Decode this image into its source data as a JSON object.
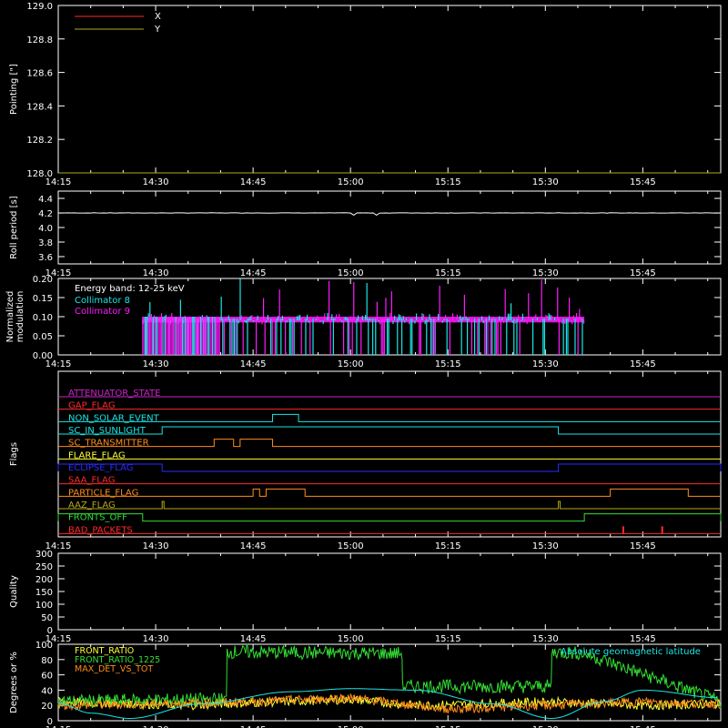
{
  "colors": {
    "background": "#000000",
    "axes": "#ffffff",
    "red": "#ff2a2a",
    "olive": "#b5a818",
    "white": "#ffffff",
    "cyan": "#19e6e6",
    "magenta": "#ff1aff",
    "green": "#33dd33",
    "orange": "#ff8c1a",
    "yellow": "#ffff33",
    "blue": "#2a2aff",
    "purple": "#cc22cc"
  },
  "time_axis": {
    "start": "14:15",
    "end": "15:57",
    "tick_labels": [
      "14:15",
      "14:30",
      "14:45",
      "15:00",
      "15:15",
      "15:30",
      "15:45"
    ]
  },
  "chart_data": [
    {
      "type": "line",
      "id": "pointing",
      "ylabel": "Pointing [\"]",
      "ylim": [
        128.0,
        129.0
      ],
      "yticks": [
        "128.0",
        "128.2",
        "128.4",
        "128.6",
        "128.8",
        "129.0"
      ],
      "legend_position": "top-left",
      "series": [
        {
          "name": "X",
          "color": "red",
          "x": [
            "14:15",
            "15:57"
          ],
          "values": [
            128.0,
            128.0
          ]
        },
        {
          "name": "Y",
          "color": "olive",
          "x": [
            "14:15",
            "15:57"
          ],
          "values": [
            128.0,
            128.0
          ]
        }
      ]
    },
    {
      "type": "line",
      "id": "roll",
      "ylabel": "Roll period [s]",
      "ylim": [
        3.5,
        4.5
      ],
      "yticks": [
        "3.6",
        "3.8",
        "4.0",
        "4.2",
        "4.4"
      ],
      "series": [
        {
          "color": "white",
          "x": [
            "14:15",
            "14:30",
            "14:45",
            "15:00",
            "15:15",
            "15:30",
            "15:45",
            "15:57"
          ],
          "values": [
            4.21,
            4.2,
            4.21,
            4.2,
            4.21,
            4.2,
            4.21,
            4.2
          ]
        }
      ]
    },
    {
      "type": "bar",
      "id": "modulation",
      "ylabel": "Normalized modulation",
      "ylim": [
        0,
        0.2
      ],
      "yticks": [
        "0.00",
        "0.05",
        "0.10",
        "0.15",
        "0.20"
      ],
      "annotation": "Energy band: 12-25 keV",
      "legend_position": "top-left",
      "active_ranges": [
        [
          "14:28",
          "15:36"
        ]
      ],
      "series": [
        {
          "name": "Collimator 8",
          "color": "cyan",
          "level": 0.09
        },
        {
          "name": "Collimator 9",
          "color": "magenta",
          "level": 0.09
        }
      ]
    },
    {
      "type": "line",
      "id": "flags",
      "ylabel": "Flags",
      "flags": [
        {
          "label": "ATTENUATOR_STATE",
          "color": "purple",
          "highs": []
        },
        {
          "label": "GAP_FLAG",
          "color": "red",
          "highs": []
        },
        {
          "label": "NON_SOLAR_EVENT",
          "color": "cyan",
          "highs": [
            [
              "14:48",
              "14:52"
            ]
          ]
        },
        {
          "label": "SC_IN_SUNLIGHT",
          "color": "cyan",
          "highs": [
            [
              "14:31",
              "15:32"
            ]
          ]
        },
        {
          "label": "SC_TRANSMITTER",
          "color": "orange",
          "highs": [
            [
              "14:39",
              "14:42"
            ],
            [
              "14:43",
              "14:48"
            ]
          ]
        },
        {
          "label": "FLARE_FLAG",
          "color": "yellow",
          "highs": []
        },
        {
          "label": "ECLIPSE_FLAG",
          "color": "blue",
          "highs": [
            [
              "14:15",
              "14:31"
            ],
            [
              "15:32",
              "15:57"
            ]
          ]
        },
        {
          "label": "SAA_FLAG",
          "color": "red",
          "highs": []
        },
        {
          "label": "PARTICLE_FLAG",
          "color": "orange",
          "highs": [
            [
              "14:45",
              "14:46"
            ],
            [
              "14:47",
              "14:53"
            ],
            [
              "15:40",
              "15:52"
            ]
          ]
        },
        {
          "label": "AAZ_FLAG",
          "color": "olive",
          "highs": [
            [
              "14:31",
              "14:31"
            ],
            [
              "15:32",
              "15:32"
            ]
          ]
        },
        {
          "label": "FRONTS_OFF",
          "color": "green",
          "highs": [
            [
              "14:15",
              "14:28"
            ],
            [
              "15:36",
              "15:57"
            ]
          ]
        },
        {
          "label": "BAD_PACKETS",
          "color": "red",
          "highs": [],
          "spikes": [
            "15:42",
            "15:48"
          ]
        }
      ]
    },
    {
      "type": "line",
      "id": "quality",
      "ylabel": "Quality",
      "ylim": [
        0,
        300
      ],
      "yticks": [
        "0",
        "50",
        "100",
        "150",
        "200",
        "250",
        "300"
      ],
      "series": []
    },
    {
      "type": "line",
      "id": "ratios",
      "ylabel": "Degrees or %",
      "ylim": [
        0,
        100
      ],
      "yticks": [
        "0",
        "20",
        "40",
        "60",
        "80",
        "100"
      ],
      "legend_position": "top-left",
      "legend_right": "Absolute geomagnetic latitude",
      "series": [
        {
          "name": "FRONT_RATIO",
          "color": "yellow",
          "x": [
            "14:15",
            "14:35",
            "14:40",
            "15:00",
            "15:10",
            "15:20",
            "15:30",
            "15:45",
            "15:57"
          ],
          "values": [
            25,
            20,
            22,
            28,
            20,
            22,
            25,
            20,
            22
          ]
        },
        {
          "name": "FRONT_RATIO_1225",
          "color": "green",
          "x": [
            "14:15",
            "14:40",
            "14:41",
            "15:06",
            "15:08",
            "15:30",
            "15:31",
            "15:36",
            "15:57"
          ],
          "values": [
            25,
            28,
            90,
            88,
            45,
            45,
            90,
            88,
            25
          ]
        },
        {
          "name": "MAX_DET_VS_TOT",
          "color": "orange",
          "x": [
            "14:15",
            "14:30",
            "14:45",
            "15:00",
            "15:15",
            "15:30",
            "15:45",
            "15:57"
          ],
          "values": [
            20,
            22,
            25,
            30,
            15,
            20,
            25,
            22
          ]
        },
        {
          "name": "Absolute geomagnetic latitude",
          "color": "cyan",
          "x": [
            "14:15",
            "14:20",
            "14:26",
            "14:37",
            "14:51",
            "15:00",
            "15:10",
            "15:22",
            "15:31",
            "15:39",
            "15:45",
            "15:57"
          ],
          "values": [
            23,
            10,
            3,
            22,
            38,
            42,
            40,
            22,
            3,
            25,
            40,
            30
          ]
        }
      ]
    }
  ]
}
